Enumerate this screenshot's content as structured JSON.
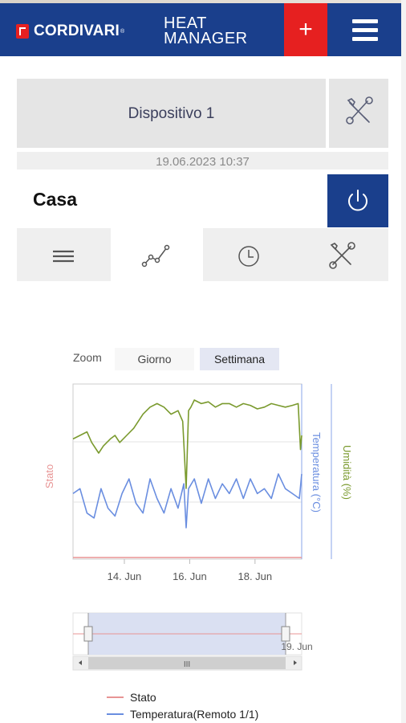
{
  "header": {
    "brand": "CORDIVARI",
    "brand_mark": "®",
    "product_line1": "HEAT",
    "product_line2": "MANAGER",
    "add_label": "+",
    "menu_icon": "hamburger-icon"
  },
  "device": {
    "name": "Dispositivo 1",
    "tool_icon": "wrench-screwdriver-icon",
    "datetime": "19.06.2023 10:37"
  },
  "zone": {
    "name": "Casa",
    "power_icon": "power-icon"
  },
  "tabs": [
    {
      "icon": "list-icon",
      "active": false
    },
    {
      "icon": "chart-line-icon",
      "active": true
    },
    {
      "icon": "clock-icon",
      "active": false
    },
    {
      "icon": "wrench-screwdriver-icon",
      "active": false
    }
  ],
  "zoom": {
    "label": "Zoom",
    "options": [
      "Giorno",
      "Settimana"
    ],
    "selected": "Settimana"
  },
  "colors": {
    "brand_blue": "#1a3f8c",
    "brand_red": "#e62020",
    "stato": "#e89494",
    "temperatura": "#6a8ee0",
    "umidita": "#7a9a2e"
  },
  "chart_data": {
    "type": "line",
    "x_ticks": [
      "14. Jun",
      "16. Jun",
      "18. Jun"
    ],
    "navigator_tick": "19. Jun",
    "axis_left_label": "Stato",
    "axis_right_label_1": "Temperatura (°C)",
    "axis_right_label_2": "Umidità (%)",
    "grid": true,
    "series": [
      {
        "name": "Umidità",
        "color": "#7a9a2e",
        "x": [
          0.0,
          0.3,
          0.6,
          0.8,
          1.1,
          1.3,
          1.6,
          1.8,
          2.0,
          2.3,
          2.6,
          3.0,
          3.3,
          3.6,
          3.9,
          4.2,
          4.5,
          4.7,
          4.85,
          4.95,
          5.05,
          5.2,
          5.5,
          5.8,
          6.1,
          6.4,
          6.7,
          7.0,
          7.3,
          7.6,
          7.9,
          8.2,
          8.5,
          8.8,
          9.1,
          9.4,
          9.65,
          9.75,
          9.8
        ],
        "values": [
          68,
          70,
          72,
          66,
          60,
          64,
          68,
          70,
          66,
          70,
          74,
          82,
          86,
          88,
          86,
          82,
          84,
          78,
          40,
          84,
          86,
          90,
          88,
          89,
          86,
          88,
          88,
          86,
          88,
          87,
          85,
          86,
          88,
          87,
          86,
          87,
          88,
          62,
          70
        ]
      },
      {
        "name": "Temperatura(Remoto 1/1)",
        "color": "#6a8ee0",
        "x": [
          0.0,
          0.3,
          0.6,
          0.9,
          1.2,
          1.5,
          1.8,
          2.1,
          2.4,
          2.7,
          3.0,
          3.3,
          3.6,
          3.9,
          4.2,
          4.5,
          4.75,
          4.85,
          4.95,
          5.2,
          5.5,
          5.8,
          6.1,
          6.4,
          6.7,
          7.0,
          7.3,
          7.6,
          7.9,
          8.2,
          8.5,
          8.8,
          9.1,
          9.4,
          9.7,
          9.8
        ],
        "values": [
          21,
          21.5,
          19,
          18.5,
          21.5,
          19.5,
          18.7,
          21,
          22.5,
          20,
          19,
          22.5,
          20.5,
          19,
          21.5,
          19.5,
          22,
          17.5,
          21.5,
          22.5,
          20,
          22.5,
          20.5,
          22,
          21,
          22.5,
          20.5,
          22.5,
          21,
          21.5,
          20.5,
          23,
          21.5,
          21,
          20.5,
          23
        ]
      },
      {
        "name": "Stato",
        "color": "#e89494",
        "x": [
          0,
          9.8
        ],
        "values": [
          0,
          0
        ]
      }
    ],
    "legend": [
      "Stato",
      "Temperatura(Remoto 1/1)"
    ]
  }
}
